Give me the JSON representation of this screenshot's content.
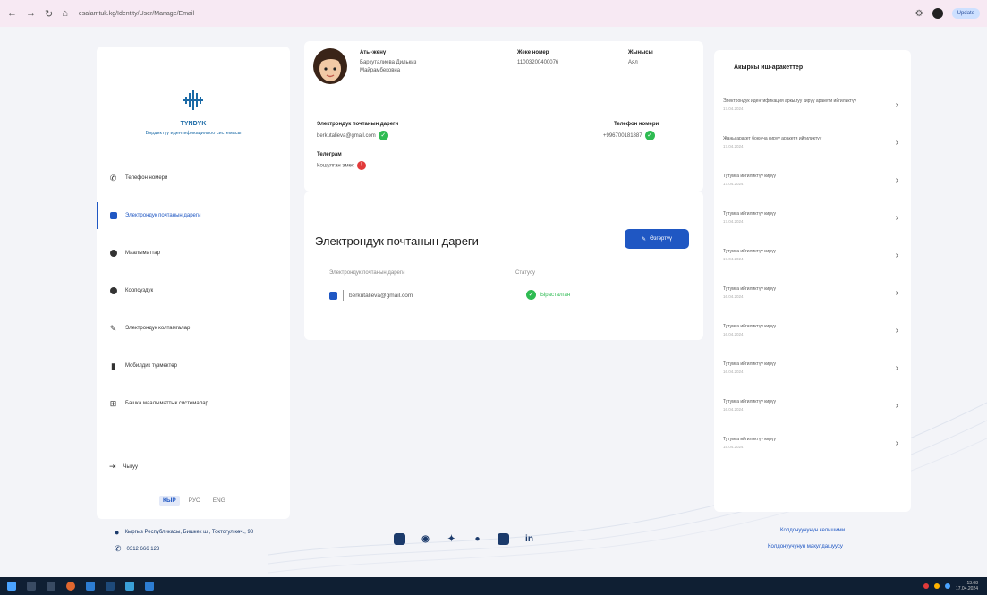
{
  "browser": {
    "url": "esalamtuk.kg/Identity/User/Manage/Email",
    "update_label": "Update"
  },
  "sidebar": {
    "brand": "TYNDYK",
    "brand_sub": "Бирдиктүү идентификациялоо системасы",
    "items": [
      {
        "label": "Телефон номери",
        "icon": "phone-icon",
        "active": false
      },
      {
        "label": "Электрондук почтанын дареги",
        "icon": "email-icon",
        "active": true
      },
      {
        "label": "Маалыматтар",
        "icon": "info-icon",
        "active": false
      },
      {
        "label": "Коопсуздук",
        "icon": "security-icon",
        "active": false
      },
      {
        "label": "Электрондук колтамгалар",
        "icon": "signature-icon",
        "active": false
      },
      {
        "label": "Мобилдик түзмөктөр",
        "icon": "mobile-icon",
        "active": false
      },
      {
        "label": "Башка маалыматтык системалар",
        "icon": "grid-icon",
        "active": false
      }
    ],
    "logout": "Чыгуу",
    "langs": [
      "КЫР",
      "РУС",
      "ENG"
    ]
  },
  "profile": {
    "name_label": "Аты-жөнү",
    "name_value": "Баркуталиева Дилькиз Майрамбековна",
    "pin_label": "Жеке номер",
    "pin_value": "11003200400076",
    "gender_label": "Жынысы",
    "gender_value": "Аял",
    "email_label": "Электрондук почтанын дареги",
    "email_value": "berkutalieva@gmail.com",
    "phone_label": "Телефон номери",
    "phone_value": "+996700181887",
    "telegram_label": "Телеграм",
    "telegram_value": "Кошулган эмес"
  },
  "email_card": {
    "title": "Электрондук почтанын дареги",
    "edit_label": "Өзгөртүү",
    "col_email": "Электрондук почтанын дареги",
    "col_status": "Статусу",
    "email_value": "berkutalieva@gmail.com",
    "status_value": "Ырасталган"
  },
  "actions": {
    "title": "Акыркы иш-аракеттер",
    "items": [
      {
        "name": "Электрондук идентификация аркылуу кирүү аракети ийгиликтүү",
        "date": "17.04.2024"
      },
      {
        "name": "Жаңы аракет боюнча кирүү аракети ийгиликтүү",
        "date": "17.04.2024"
      },
      {
        "name": "Тутумга ийгиликтүү кирүү",
        "date": "17.04.2024"
      },
      {
        "name": "Тутумга ийгиликтүү кирүү",
        "date": "17.04.2024"
      },
      {
        "name": "Тутумга ийгиликтүү кирүү",
        "date": "17.04.2024"
      },
      {
        "name": "Тутумга ийгиликтүү кирүү",
        "date": "16.04.2024"
      },
      {
        "name": "Тутумга ийгиликтүү кирүү",
        "date": "16.04.2024"
      },
      {
        "name": "Тутумга ийгиликтүү кирүү",
        "date": "16.04.2024"
      },
      {
        "name": "Тутумга ийгиликтүү кирүү",
        "date": "16.04.2024"
      },
      {
        "name": "Тутумга ийгиликтүү кирүү",
        "date": "15.04.2024"
      }
    ]
  },
  "footer": {
    "address": "Кыргыз Республикасы, Бишкек ш., Токтогул көч., 98",
    "phone": "0312 666 123",
    "link1": "Колдонуучунун келишими",
    "link2": "Колдонуучунун макулдашуусу"
  },
  "taskbar": {
    "time": "13:08",
    "date": "17.04.2024"
  }
}
